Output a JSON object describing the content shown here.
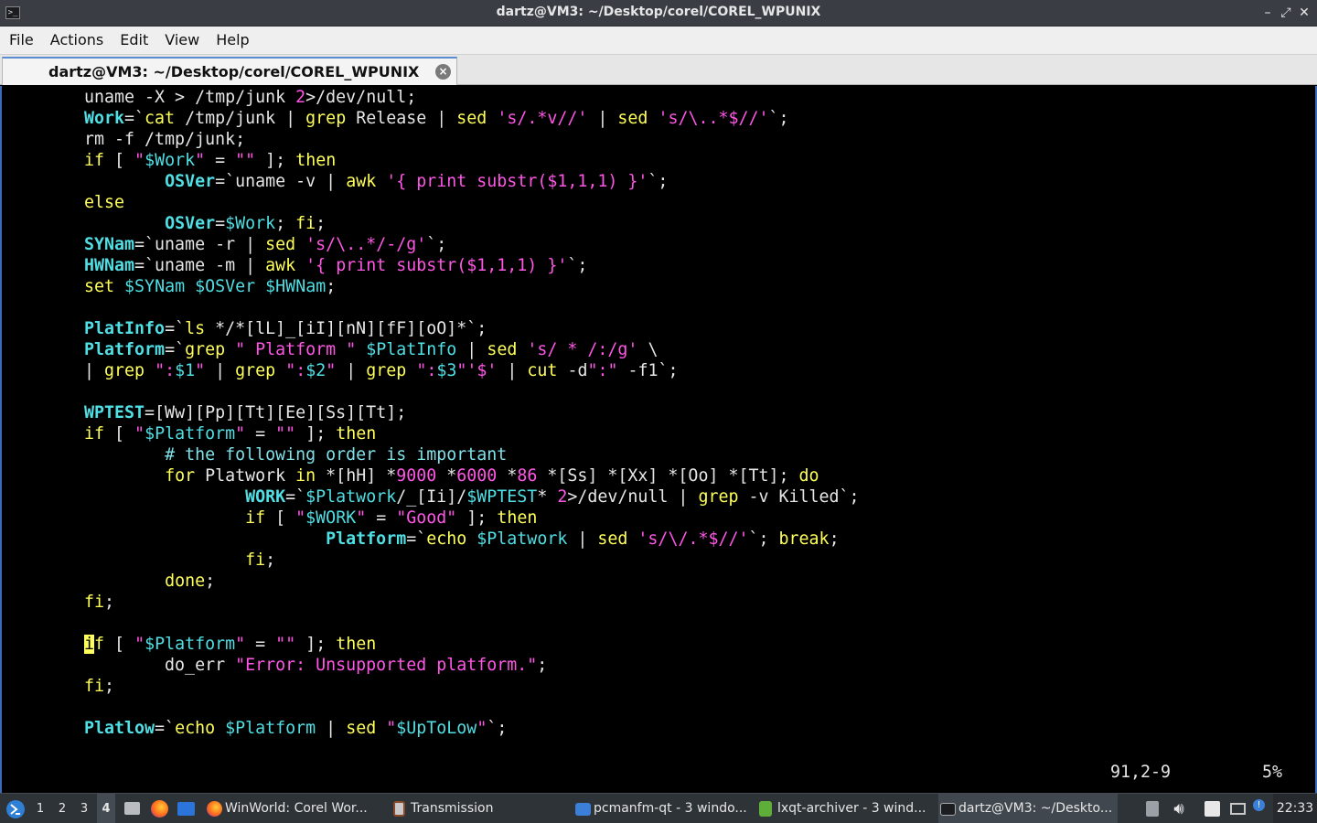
{
  "window": {
    "title": "dartz@VM3: ~/Desktop/corel/COREL_WPUNIX"
  },
  "menu": [
    "File",
    "Actions",
    "Edit",
    "View",
    "Help"
  ],
  "tab": {
    "label": "dartz@VM3: ~/Desktop/corel/COREL_WPUNIX",
    "close": "×"
  },
  "status": {
    "position": "91,2-9",
    "percent": "5%"
  },
  "taskbar": {
    "workspaces": [
      "1",
      "2",
      "3",
      "4"
    ],
    "active_workspace": "4",
    "tasks": [
      {
        "label": "WinWorld: Corel Wor...",
        "icon": "firefox-icon"
      },
      {
        "label": "Transmission",
        "icon": "transmission-icon"
      },
      {
        "label": "pcmanfm-qt - 3 windo...",
        "icon": "folder-icon"
      },
      {
        "label": "lxqt-archiver - 3 wind...",
        "icon": "archive-icon"
      },
      {
        "label": "dartz@VM3: ~/Deskto...",
        "icon": "terminal-icon"
      }
    ],
    "clock": "22:33"
  },
  "colors": {
    "keyword": "#ffff5a",
    "variable": "#4fdfe4",
    "string": "#ff56e6",
    "accent": "#3c6cb8"
  }
}
